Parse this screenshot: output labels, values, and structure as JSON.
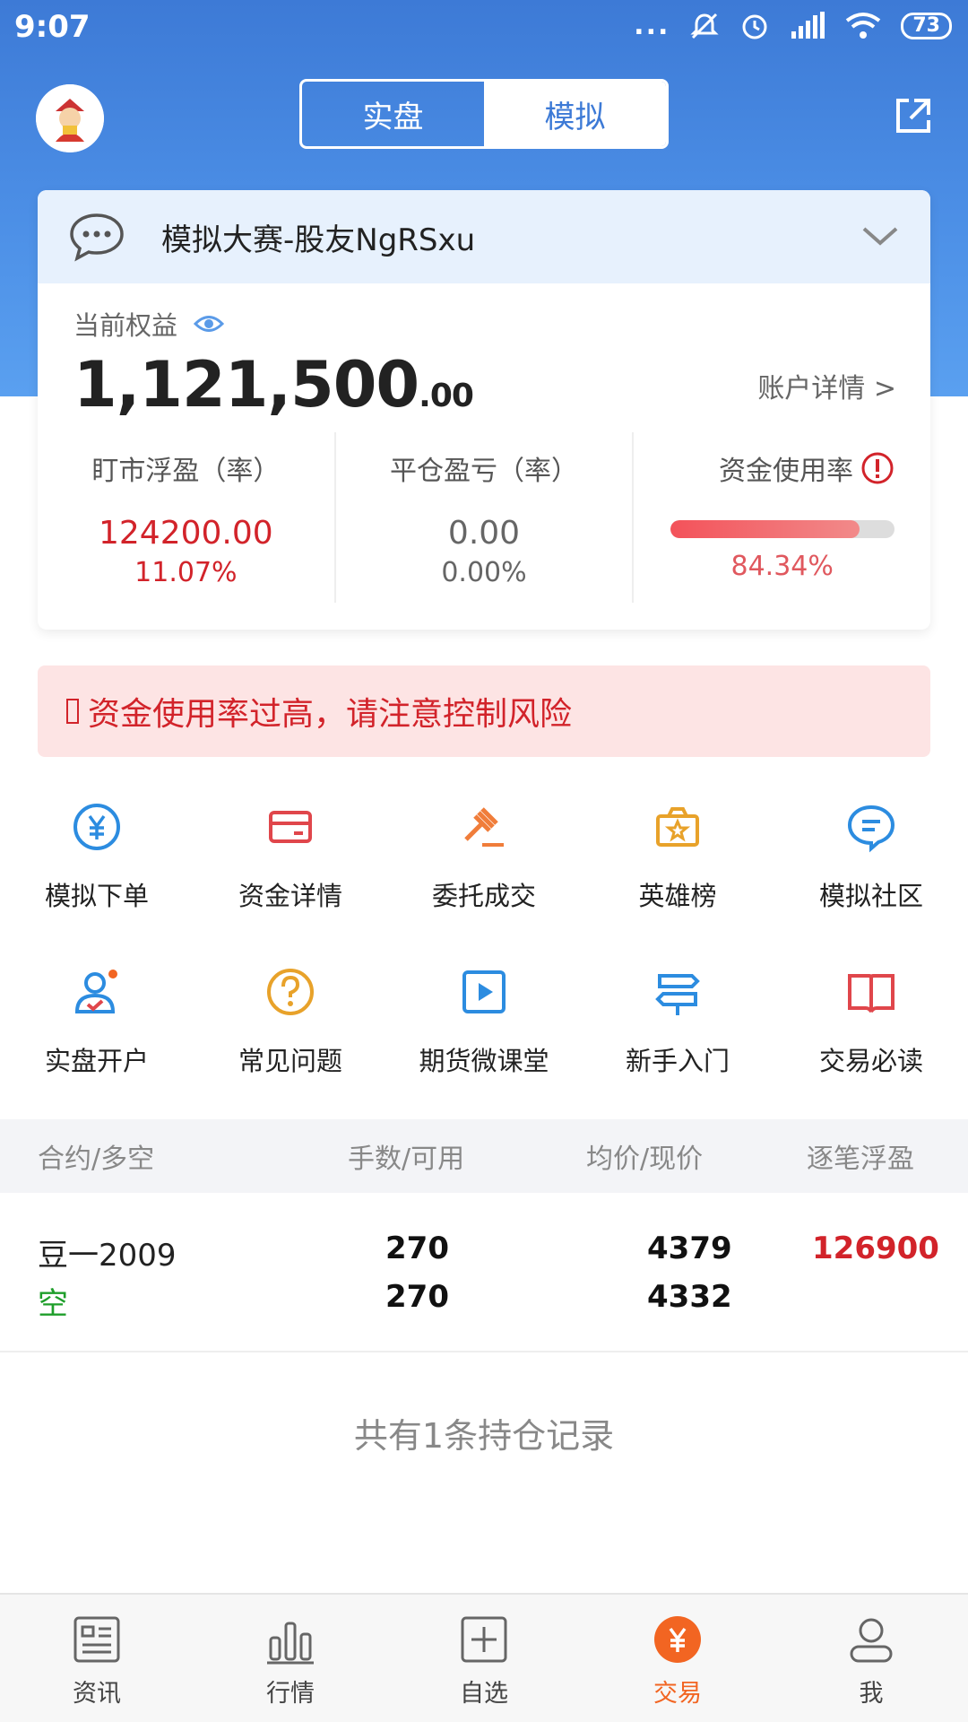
{
  "status_bar": {
    "time": "9:07",
    "dots": "...",
    "battery": "73"
  },
  "header": {
    "tabs": [
      {
        "label": "实盘"
      },
      {
        "label": "模拟"
      }
    ],
    "active_tab": "模拟"
  },
  "account": {
    "contest_name": "模拟大赛-股友NgRSxu",
    "equity_label": "当前权益",
    "equity_integer": "1,121,500",
    "equity_decimal": ".00",
    "detail_link": "账户详情 >",
    "stats": [
      {
        "label": "盯市浮盈（率）",
        "value": "124200.00",
        "rate": "11.07%"
      },
      {
        "label": "平仓盈亏（率）",
        "value": "0.00",
        "rate": "0.00%"
      },
      {
        "label": "资金使用率",
        "rate": "84.34%",
        "usage_fraction": 0.8434
      }
    ]
  },
  "warning": {
    "text": "资金使用率过高，请注意控制风险"
  },
  "menu": {
    "row1": [
      {
        "label": "模拟下单",
        "icon": "yuan-circle-icon"
      },
      {
        "label": "资金详情",
        "icon": "card-icon"
      },
      {
        "label": "委托成交",
        "icon": "gavel-icon"
      },
      {
        "label": "英雄榜",
        "icon": "star-box-icon"
      },
      {
        "label": "模拟社区",
        "icon": "chat-bubble-icon"
      }
    ],
    "row2": [
      {
        "label": "实盘开户",
        "icon": "user-check-icon"
      },
      {
        "label": "常见问题",
        "icon": "question-icon"
      },
      {
        "label": "期货微课堂",
        "icon": "play-icon"
      },
      {
        "label": "新手入门",
        "icon": "signpost-icon"
      },
      {
        "label": "交易必读",
        "icon": "book-icon"
      }
    ]
  },
  "positions": {
    "headers": [
      "合约/多空",
      "手数/可用",
      "均价/现价",
      "逐笔浮盈"
    ],
    "rows": [
      {
        "contract": "豆一2009",
        "direction": "空",
        "lots": "270",
        "available": "270",
        "avg_price": "4379",
        "current_price": "4332",
        "pnl": "126900"
      }
    ],
    "summary": "共有1条持仓记录"
  },
  "bottom_nav": [
    {
      "label": "资讯",
      "icon": "news-icon"
    },
    {
      "label": "行情",
      "icon": "bars-icon"
    },
    {
      "label": "自选",
      "icon": "plus-box-icon"
    },
    {
      "label": "交易",
      "icon": "yuan-active-icon",
      "active": true
    },
    {
      "label": "我",
      "icon": "user-icon"
    }
  ]
}
